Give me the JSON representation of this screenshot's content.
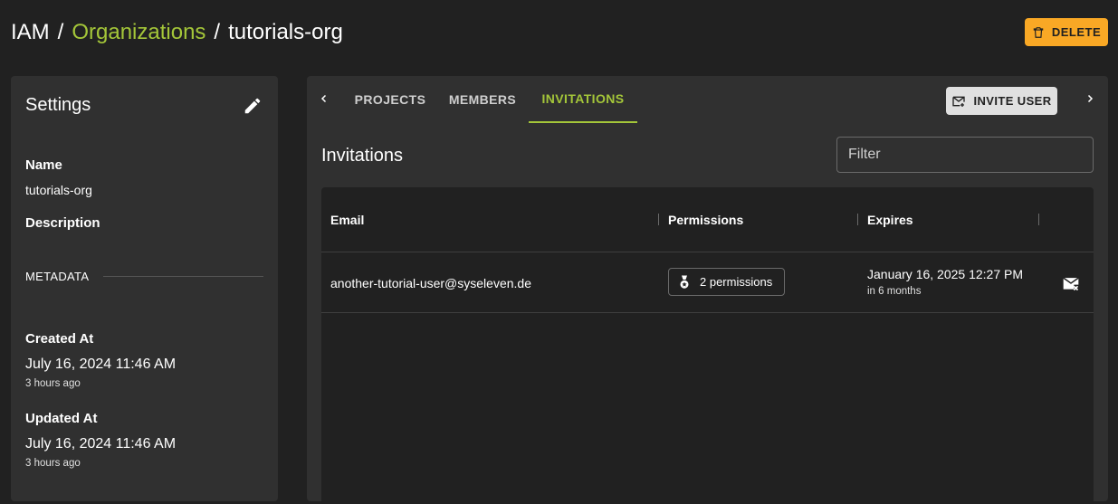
{
  "breadcrumb": {
    "root": "IAM",
    "separator": "/",
    "parent": "Organizations",
    "current": "tutorials-org"
  },
  "header": {
    "delete_label": "DELETE"
  },
  "settings": {
    "title": "Settings",
    "name_label": "Name",
    "name_value": "tutorials-org",
    "description_label": "Description",
    "metadata_label": "METADATA",
    "created_label": "Created At",
    "created_value": "July 16, 2024 11:46 AM",
    "created_relative": "3 hours ago",
    "updated_label": "Updated At",
    "updated_value": "July 16, 2024 11:46 AM",
    "updated_relative": "3 hours ago"
  },
  "tabs": {
    "items": [
      {
        "label": "PROJECTS"
      },
      {
        "label": "MEMBERS"
      },
      {
        "label": "INVITATIONS"
      }
    ],
    "active": "INVITATIONS",
    "invite_label": "INVITE USER"
  },
  "invitations": {
    "title": "Invitations",
    "filter_placeholder": "Filter",
    "columns": [
      "Email",
      "Permissions",
      "Expires"
    ],
    "rows": [
      {
        "email": "another-tutorial-user@syseleven.de",
        "permissions": "2 permissions",
        "expires": "January 16, 2025 12:27 PM",
        "expires_relative": "in 6 months"
      }
    ]
  },
  "colors": {
    "accent": "#a4c639",
    "delete": "#f9a825",
    "background": "#212121",
    "card": "#303030"
  },
  "icons": {
    "delete": "trash-icon",
    "edit": "pencil-icon",
    "invite": "mail-plus-icon",
    "permissions": "badge-icon",
    "resend": "mail-x-icon",
    "tab_prev": "chevron-left-icon",
    "tab_next": "chevron-right-icon"
  }
}
